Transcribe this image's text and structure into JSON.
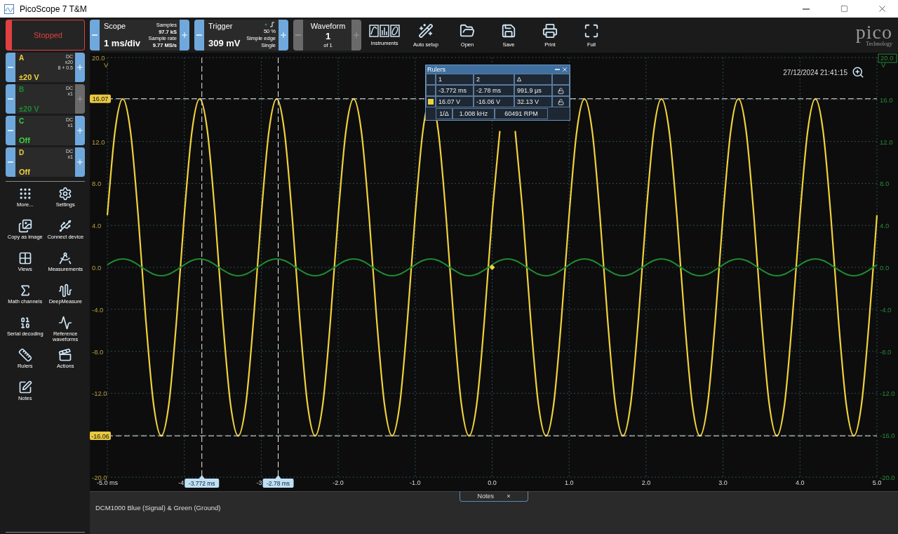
{
  "window": {
    "title": "PicoScope 7 T&M"
  },
  "run_button": {
    "label": "Stopped",
    "running": false
  },
  "scope": {
    "title": "Scope",
    "value": "1 ms/div",
    "lines": [
      "Samples",
      "97.7 kS",
      "Sample rate",
      "9.77 MS/s"
    ],
    "minus_enabled": true,
    "plus_enabled": true
  },
  "trigger": {
    "title": "Trigger",
    "value": "309 mV",
    "lines": [
      "50 %",
      "Simple edge",
      "Single"
    ],
    "minus_enabled": true,
    "plus_enabled": true
  },
  "waveform": {
    "title": "Waveform",
    "value": "1",
    "sub": "of 1",
    "minus_enabled": false,
    "plus_enabled": false
  },
  "toolbar": [
    {
      "label": "Instruments"
    },
    {
      "label": "Auto setup"
    },
    {
      "label": "Open"
    },
    {
      "label": "Save"
    },
    {
      "label": "Print"
    },
    {
      "label": "Full"
    }
  ],
  "brand": {
    "name": "pico",
    "tagline": "Technology"
  },
  "channels": [
    {
      "letter": "A",
      "color": "#f0d23c",
      "coupling": "DC",
      "probe": "x20",
      "extra": "8 + 0.5",
      "range": "±20 V",
      "plus_enabled": true
    },
    {
      "letter": "B",
      "color": "#1f8a30",
      "coupling": "DC",
      "probe": "x1",
      "range": "±20 V",
      "plus_enabled": false
    },
    {
      "letter": "C",
      "color": "#3ed23e",
      "coupling": "DC",
      "probe": "x1",
      "range": "Off",
      "plus_enabled": true
    },
    {
      "letter": "D",
      "color": "#f0d23c",
      "coupling": "DC",
      "probe": "x1",
      "range": "Off",
      "plus_enabled": true
    }
  ],
  "tools": [
    {
      "label": "More..."
    },
    {
      "label": "Settings"
    },
    {
      "label": "Copy as image"
    },
    {
      "label": "Connect device"
    },
    {
      "label": "Views"
    },
    {
      "label": "Measurements"
    },
    {
      "label": "Math channels"
    },
    {
      "label": "DeepMeasure"
    },
    {
      "label": "Serial decoding"
    },
    {
      "label": "Reference waveforms"
    },
    {
      "label": "Rulers"
    },
    {
      "label": "Actions"
    },
    {
      "label": "Notes"
    }
  ],
  "timestamp": "27/12/2024 21:41:15",
  "rulers_panel": {
    "title": "Rulers",
    "header": [
      "1",
      "2",
      "Δ"
    ],
    "rows": [
      {
        "cells": [
          "-3.772 ms",
          "-2.78 ms",
          "991.9 µs"
        ],
        "locked": false
      },
      {
        "color": "#f0d23c",
        "cells": [
          "16.07 V",
          "-16.06 V",
          "32.13 V"
        ],
        "locked": false
      }
    ],
    "footer": {
      "label": "1/Δ",
      "cells": [
        "1.008 kHz",
        "60491 RPM"
      ]
    }
  },
  "plot": {
    "chart_data": {
      "type": "line",
      "ylabel": "V",
      "xlim": [
        -5,
        5
      ],
      "ylim": [
        -20,
        20
      ],
      "xticks": [
        {
          "value": -5,
          "label": "-5.0 ms"
        },
        {
          "value": -4,
          "label": "-4"
        },
        {
          "value": -3,
          "label": "-3"
        },
        {
          "value": -2,
          "label": "-2.0"
        },
        {
          "value": -1,
          "label": "-1.0"
        },
        {
          "value": 0,
          "label": "0.0"
        },
        {
          "value": 1,
          "label": "1.0"
        },
        {
          "value": 2,
          "label": "2.0"
        },
        {
          "value": 3,
          "label": "3.0"
        },
        {
          "value": 4,
          "label": "4.0"
        },
        {
          "value": 5,
          "label": "5.0"
        }
      ],
      "yticks": [
        {
          "value": 20,
          "label": "20.0"
        },
        {
          "value": 16,
          "label": "16.0"
        },
        {
          "value": 12,
          "label": "12.0"
        },
        {
          "value": 8,
          "label": "8.0"
        },
        {
          "value": 4,
          "label": "4.0"
        },
        {
          "value": 0,
          "label": "0.0"
        },
        {
          "value": -4,
          "label": "-4.0"
        },
        {
          "value": -8,
          "label": "-8.0"
        },
        {
          "value": -12,
          "label": "-12.0"
        },
        {
          "value": -16,
          "label": "-16.0"
        },
        {
          "value": -20,
          "label": "-20.0"
        }
      ],
      "x": [
        -5,
        -4.9,
        -4.8,
        -4.7,
        -4.6,
        -4.5,
        -4.4,
        -4.3,
        -4.2,
        -4.1,
        -4,
        -3.9,
        -3.8,
        -3.7,
        -3.6,
        -3.5,
        -3.4,
        -3.3,
        -3.2,
        -3.1,
        -3,
        -2.9,
        -2.8,
        -2.7,
        -2.6,
        -2.5,
        -2.4,
        -2.3,
        -2.2,
        -2.1,
        -2,
        -1.9,
        -1.8,
        -1.7,
        -1.6,
        -1.5,
        -1.4,
        -1.3,
        -1.2,
        -1.1,
        -1,
        -0.9,
        -0.8,
        -0.7,
        -0.6,
        -0.5,
        -0.4,
        -0.3,
        -0.2,
        -0.1,
        0,
        0.1,
        0.2,
        0.3,
        0.4,
        0.5,
        0.6,
        0.7,
        0.8,
        0.9,
        1,
        1.1,
        1.2,
        1.3,
        1.4,
        1.5,
        1.6,
        1.7,
        1.8,
        1.9,
        2,
        2.1,
        2.2,
        2.3,
        2.4,
        2.5,
        2.6,
        2.7,
        2.8,
        2.9,
        3,
        3.1,
        3.2,
        3.3,
        3.4,
        3.5,
        3.6,
        3.7,
        3.8,
        3.9,
        4,
        4.1,
        4.2,
        4.3,
        4.4,
        4.5,
        4.6,
        4.7,
        4.8,
        4.9,
        5
      ],
      "series": [
        {
          "color": "#f0d23c",
          "values": [
            4.97,
            13.0,
            16.07,
            13.0,
            4.97,
            -4.97,
            -13.0,
            -16.07,
            -13.0,
            -4.97,
            4.97,
            13.0,
            16.07,
            13.0,
            4.97,
            -4.97,
            -13.0,
            -16.07,
            -13.0,
            -4.97,
            4.97,
            13.0,
            16.07,
            13.0,
            4.97,
            -4.97,
            -13.0,
            -16.07,
            -13.0,
            -4.97,
            4.97,
            13.0,
            16.07,
            13.0,
            4.97,
            -4.97,
            -13.0,
            -16.07,
            -13.0,
            -4.97,
            4.97,
            13.0,
            16.07,
            13.0,
            4.97,
            -4.97,
            -13.0,
            -16.07,
            -13.0,
            -4.97,
            4.97,
            13.0,
            null,
            13.0,
            4.97,
            -4.97,
            -13.0,
            -16.07,
            -13.0,
            -4.97,
            4.97,
            13.0,
            16.07,
            13.0,
            4.97,
            -4.97,
            -13.0,
            -16.07,
            -13.0,
            -4.97,
            4.97,
            13.0,
            16.07,
            13.0,
            4.97,
            -4.97,
            -13.0,
            -16.07,
            -13.0,
            -4.97,
            4.97,
            13.0,
            16.07,
            13.0,
            4.97,
            -4.97,
            -13.0,
            -16.07,
            -13.0,
            -4.97,
            4.97,
            13.0,
            16.07,
            13.0,
            4.97,
            -4.97,
            -13.0,
            -16.07,
            -13.0,
            -4.97,
            4.97
          ]
        },
        {
          "color": "#1f8a30",
          "values": [
            0.25,
            0.65,
            0.8,
            0.65,
            0.25,
            -0.25,
            -0.65,
            -0.8,
            -0.65,
            -0.25,
            0.25,
            0.65,
            0.8,
            0.65,
            0.25,
            -0.25,
            -0.65,
            -0.8,
            -0.65,
            -0.25,
            0.25,
            0.65,
            0.8,
            0.65,
            0.25,
            -0.25,
            -0.65,
            -0.8,
            -0.65,
            -0.25,
            0.25,
            0.65,
            0.8,
            0.65,
            0.25,
            -0.25,
            -0.65,
            -0.8,
            -0.65,
            -0.25,
            0.25,
            0.65,
            0.8,
            0.65,
            0.25,
            -0.25,
            -0.65,
            -0.8,
            -0.65,
            -0.25,
            0.25,
            0.65,
            0.8,
            0.65,
            0.25,
            -0.25,
            -0.65,
            -0.8,
            -0.65,
            -0.25,
            0.25,
            0.65,
            0.8,
            0.65,
            0.25,
            -0.25,
            -0.65,
            -0.8,
            -0.65,
            -0.25,
            0.25,
            0.65,
            0.8,
            0.65,
            0.25,
            -0.25,
            -0.65,
            -0.8,
            -0.65,
            -0.25,
            0.25,
            0.65,
            0.8,
            0.65,
            0.25,
            -0.25,
            -0.65,
            -0.8,
            -0.65,
            -0.25,
            0.25,
            0.65,
            0.8,
            0.65,
            0.25,
            -0.25,
            -0.65,
            -0.8,
            -0.65,
            -0.25,
            0.25
          ]
        }
      ],
      "grid": true,
      "annotations": [
        "-3.772 ms",
        "-2.78 ms",
        "16.07",
        "-16.06"
      ]
    }
  },
  "notes": {
    "tab": "Notes",
    "close": "×",
    "text": "DCM1000 Blue (Signal) & Green (Ground)"
  }
}
